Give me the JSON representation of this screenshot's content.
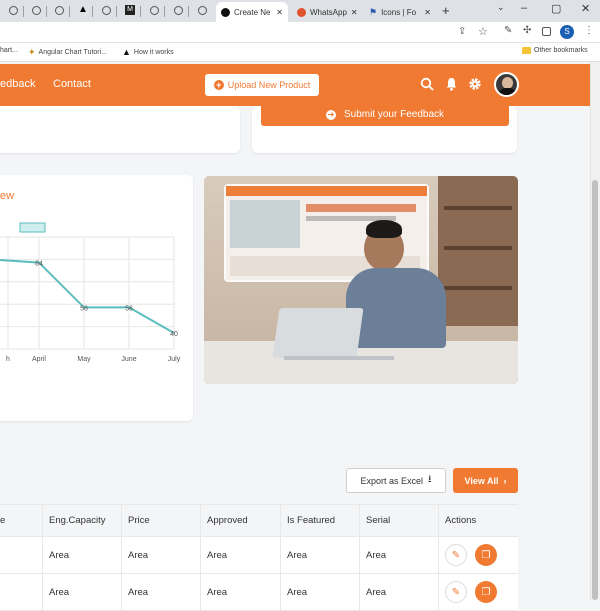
{
  "browser": {
    "tabs": [
      {
        "label": "Create Ne",
        "active": true
      },
      {
        "label": "WhatsApp",
        "active": false
      },
      {
        "label": "Icons | Fo",
        "active": false
      }
    ],
    "new_tab": "+",
    "bookmarks": [
      "Angular Chart Tutori...",
      "How it works"
    ],
    "bookmarks_prefix": "hart...",
    "other_bookmarks": "Other bookmarks",
    "profile_initial": "S"
  },
  "header": {
    "nav": [
      "edback",
      "Contact"
    ],
    "upload_label": "Upload New Product"
  },
  "feedback": {
    "button_label": "Submit your Feedback"
  },
  "chart_data": {
    "type": "line",
    "title": "ew",
    "categories": [
      "h",
      "April",
      "May",
      "June",
      "July"
    ],
    "series": [
      {
        "values": [
          null,
          84,
          56,
          56,
          40
        ]
      }
    ],
    "point_labels": [
      "",
      "84",
      "56",
      "56",
      "40"
    ],
    "color": "#5bbcbf",
    "ylim": [
      30,
      100
    ],
    "grid": true
  },
  "table": {
    "export_label": "Export as Excel",
    "view_all_label": "View All",
    "columns": [
      "e",
      "Eng.Capacity",
      "Price",
      "Approved",
      "Is Featured",
      "Serial",
      "Actions"
    ],
    "rows": [
      [
        "",
        "Area",
        "Area",
        "Area",
        "Area",
        "Area"
      ],
      [
        "",
        "Area",
        "Area",
        "Area",
        "Area",
        "Area"
      ]
    ]
  },
  "colors": {
    "accent": "#f07a32",
    "line": "#5bbcbf"
  }
}
